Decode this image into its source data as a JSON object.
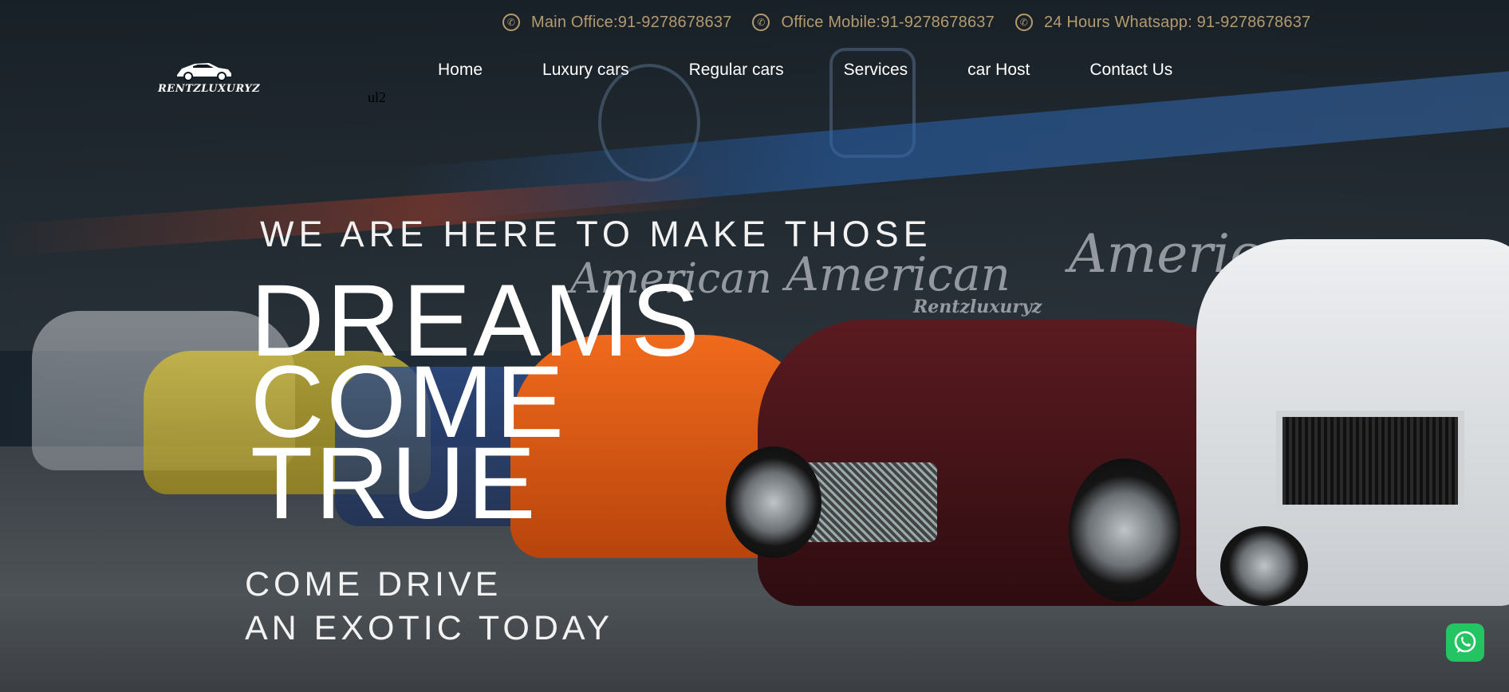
{
  "topbar": {
    "contacts": [
      {
        "icon": "phone-icon",
        "text": "Main Office:91-9278678637"
      },
      {
        "icon": "phone-icon",
        "text": "Office Mobile:91-9278678637"
      },
      {
        "icon": "phone-icon",
        "text": "24 Hours Whatsapp: 91-9278678637"
      }
    ]
  },
  "logo": {
    "icon": "car-logo-icon",
    "text": "RENTZLUXURYZ"
  },
  "stray_text": "ul2",
  "nav": {
    "items": [
      {
        "label": "Home"
      },
      {
        "label": "Luxury cars"
      },
      {
        "label": "Regular cars"
      },
      {
        "label": "Services"
      },
      {
        "label": "car Host"
      },
      {
        "label": "Contact Us"
      }
    ]
  },
  "hero": {
    "kicker": "WE ARE HERE TO MAKE THOSE",
    "headline": [
      "DREAMS",
      "COME",
      "TRUE"
    ],
    "sub": [
      "COME DRIVE",
      "AN EXOTIC TODAY"
    ],
    "background": {
      "wall_text_1": "American",
      "wall_text_2": "Rentzluxuryz"
    }
  },
  "whatsapp": {
    "icon": "whatsapp-icon"
  },
  "colors": {
    "contact_gold": "#b39a6f",
    "whatsapp_green": "#25c463",
    "text_white": "#ffffff"
  }
}
